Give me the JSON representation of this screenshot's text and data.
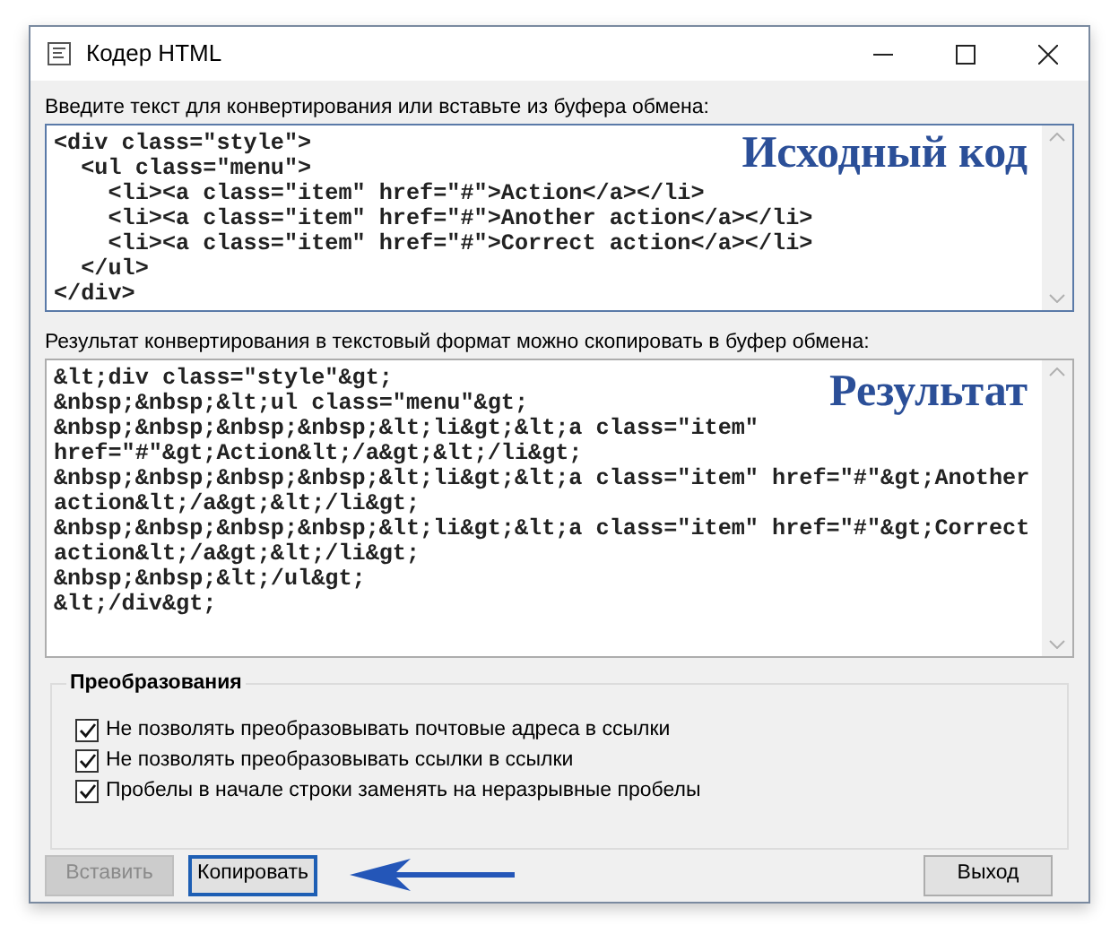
{
  "window": {
    "title": "Кодер HTML"
  },
  "source": {
    "label": "Введите текст для конвертирования или вставьте из буфера обмена:",
    "annotation": "Исходный код",
    "lines": [
      "<div class=\"style\">",
      "  <ul class=\"menu\">",
      "    <li><a class=\"item\" href=\"#\">Action</a></li>",
      "    <li><a class=\"item\" href=\"#\">Another action</a></li>",
      "    <li><a class=\"item\" href=\"#\">Correct action</a></li>",
      "  </ul>",
      "</div>"
    ]
  },
  "result": {
    "label": "Результат конвертирования в текстовый формат можно скопировать в буфер обмена:",
    "annotation": "Результат",
    "lines": [
      "&lt;div class=\"style\"&gt;",
      "&nbsp;&nbsp;&lt;ul class=\"menu\"&gt;",
      "&nbsp;&nbsp;&nbsp;&nbsp;&lt;li&gt;&lt;a class=\"item\"",
      "href=\"#\"&gt;Action&lt;/a&gt;&lt;/li&gt;",
      "&nbsp;&nbsp;&nbsp;&nbsp;&lt;li&gt;&lt;a class=\"item\" href=\"#\"&gt;Another",
      "action&lt;/a&gt;&lt;/li&gt;",
      "&nbsp;&nbsp;&nbsp;&nbsp;&lt;li&gt;&lt;a class=\"item\" href=\"#\"&gt;Correct",
      "action&lt;/a&gt;&lt;/li&gt;",
      "&nbsp;&nbsp;&lt;/ul&gt;",
      "&lt;/div&gt;"
    ]
  },
  "options": {
    "title": "Преобразования",
    "items": [
      {
        "label": "Не позволять преобразовывать почтовые адреса в ссылки",
        "checked": true
      },
      {
        "label": "Не позволять преобразовывать ссылки в ссылки",
        "checked": true
      },
      {
        "label": "Пробелы в начале строки заменять на неразрывные пробелы",
        "checked": true
      }
    ]
  },
  "buttons": [
    {
      "label": "Вставить",
      "disabled": true,
      "focused": false,
      "pointed_at": false
    },
    {
      "label": "Копировать",
      "disabled": false,
      "focused": true,
      "pointed_at": true
    },
    {
      "label": "Выход",
      "disabled": false,
      "focused": false,
      "pointed_at": false
    }
  ]
}
